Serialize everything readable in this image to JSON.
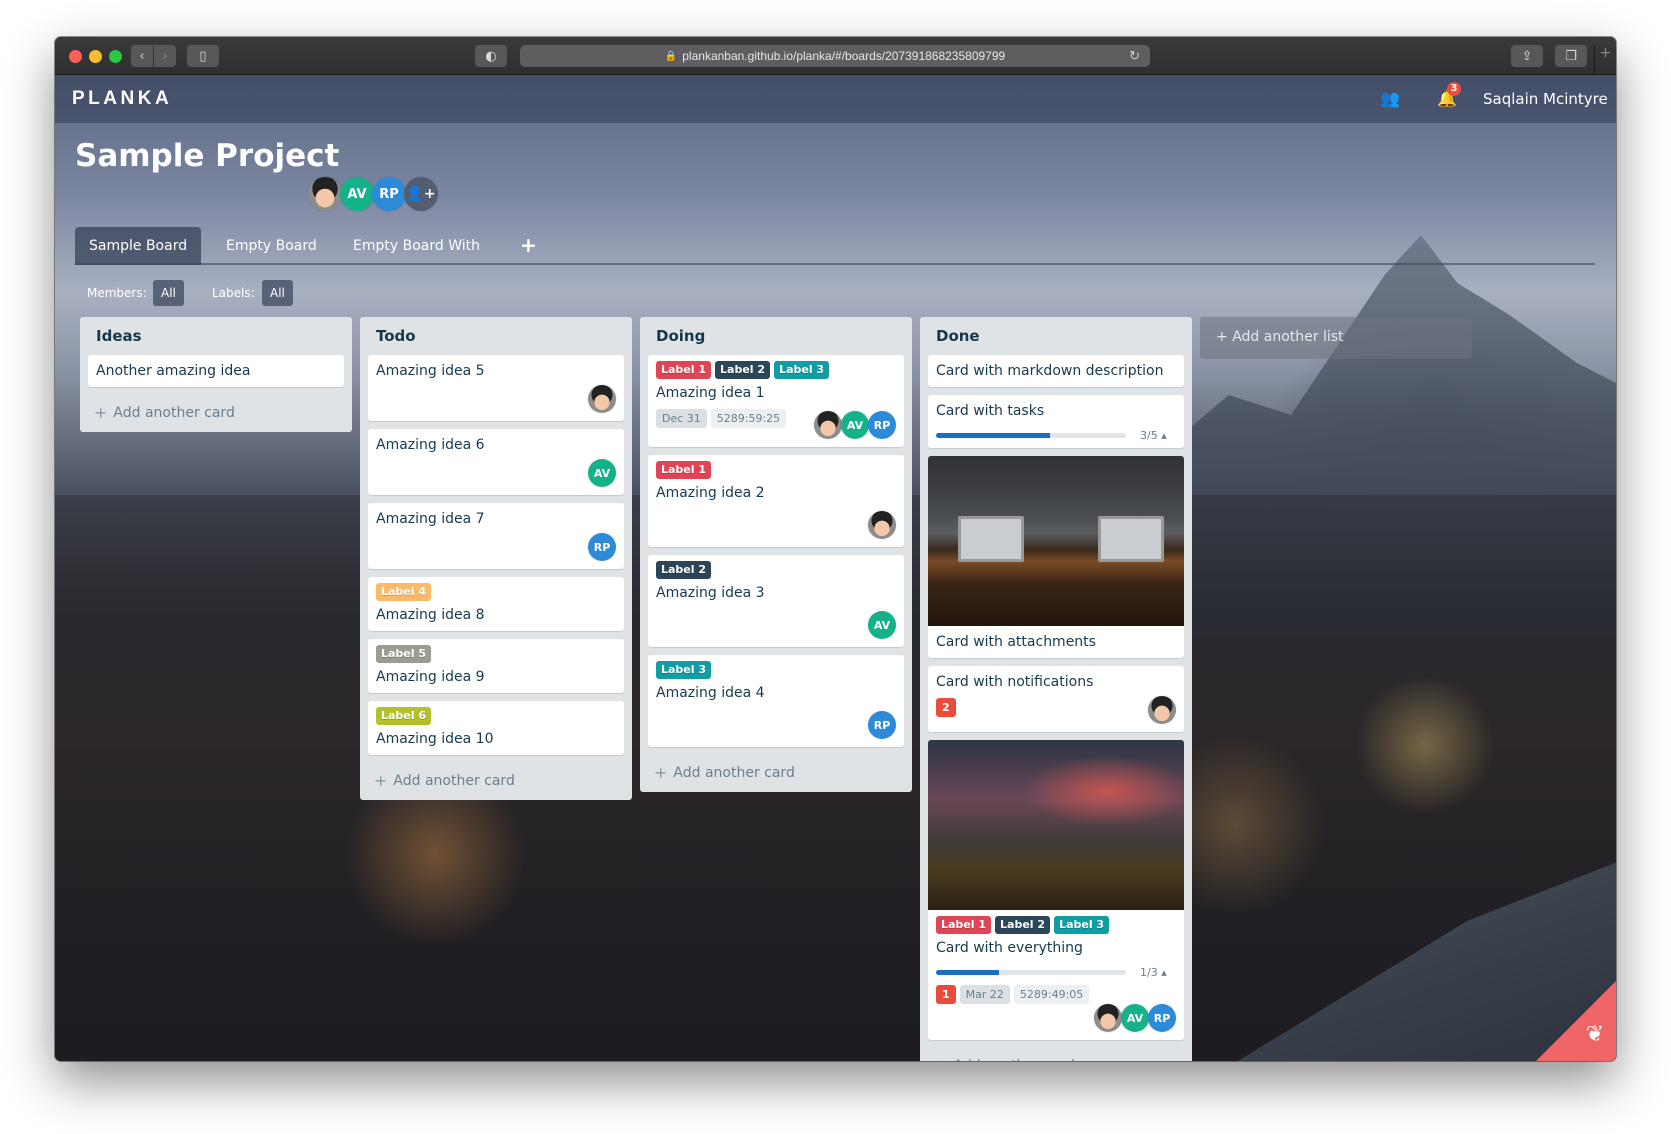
{
  "browser": {
    "url": "plankanban.github.io/planka/#/boards/207391868235809799"
  },
  "header": {
    "logo": "PLANKA",
    "user_name": "Saqlain Mcintyre",
    "notification_count": "3"
  },
  "project": {
    "title": "Sample Project",
    "members": [
      {
        "initials": "",
        "type": "photo"
      },
      {
        "initials": "AV",
        "color": "#15b28a"
      },
      {
        "initials": "RP",
        "color": "#2d8ad8"
      }
    ]
  },
  "tabs": [
    {
      "label": "Sample Board",
      "active": true
    },
    {
      "label": "Empty Board",
      "active": false
    },
    {
      "label": "Empty Board With",
      "active": false
    }
  ],
  "tab_add": "+",
  "filters": {
    "members_label": "Members:",
    "members_value": "All",
    "labels_label": "Labels:",
    "labels_value": "All"
  },
  "label_colors": {
    "Label 1": "#e04556",
    "Label 2": "#2b4658",
    "Label 3": "#109ea4",
    "Label 4": "#fdb96a",
    "Label 5": "#9d9c90",
    "Label 6": "#b3c12a"
  },
  "lists": [
    {
      "title": "Ideas",
      "cards": [
        {
          "title": "Another amazing idea"
        }
      ],
      "add_card": "Add another card"
    },
    {
      "title": "Todo",
      "cards": [
        {
          "title": "Amazing idea 5",
          "members": [
            "photo"
          ]
        },
        {
          "title": "Amazing idea 6",
          "members": [
            "AV"
          ]
        },
        {
          "title": "Amazing idea 7",
          "members": [
            "RP"
          ]
        },
        {
          "title": "Amazing idea 8",
          "labels": [
            "Label 4"
          ]
        },
        {
          "title": "Amazing idea 9",
          "labels": [
            "Label 5"
          ]
        },
        {
          "title": "Amazing idea 10",
          "labels": [
            "Label 6"
          ]
        }
      ],
      "add_card": "Add another card"
    },
    {
      "title": "Doing",
      "cards": [
        {
          "title": "Amazing idea 1",
          "labels": [
            "Label 1",
            "Label 2",
            "Label 3"
          ],
          "due": "Dec 31",
          "timer": "5289:59:25",
          "members": [
            "photo",
            "AV",
            "RP"
          ]
        },
        {
          "title": "Amazing idea 2",
          "labels": [
            "Label 1"
          ],
          "members": [
            "photo"
          ]
        },
        {
          "title": "Amazing idea 3",
          "labels": [
            "Label 2"
          ],
          "members": [
            "AV"
          ]
        },
        {
          "title": "Amazing idea 4",
          "labels": [
            "Label 3"
          ],
          "members": [
            "RP"
          ]
        }
      ],
      "add_card": "Add another card"
    },
    {
      "title": "Done",
      "cards": [
        {
          "title": "Card with markdown description"
        },
        {
          "title": "Card with tasks",
          "tasks_done": 3,
          "tasks_total": 5,
          "tasks_text": "3/5"
        },
        {
          "title": "Card with attachments",
          "cover": "desk"
        },
        {
          "title": "Card with notifications",
          "notifications": "2",
          "members": [
            "photo"
          ]
        },
        {
          "title": "Card with everything",
          "cover": "bike",
          "labels": [
            "Label 1",
            "Label 2",
            "Label 3"
          ],
          "tasks_done": 1,
          "tasks_total": 3,
          "tasks_text": "1/3",
          "notifications": "1",
          "due": "Mar 22",
          "timer": "5289:49:05",
          "members": [
            "photo",
            "AV",
            "RP"
          ]
        }
      ],
      "add_card": "Add another card"
    }
  ],
  "add_list": "Add another list"
}
